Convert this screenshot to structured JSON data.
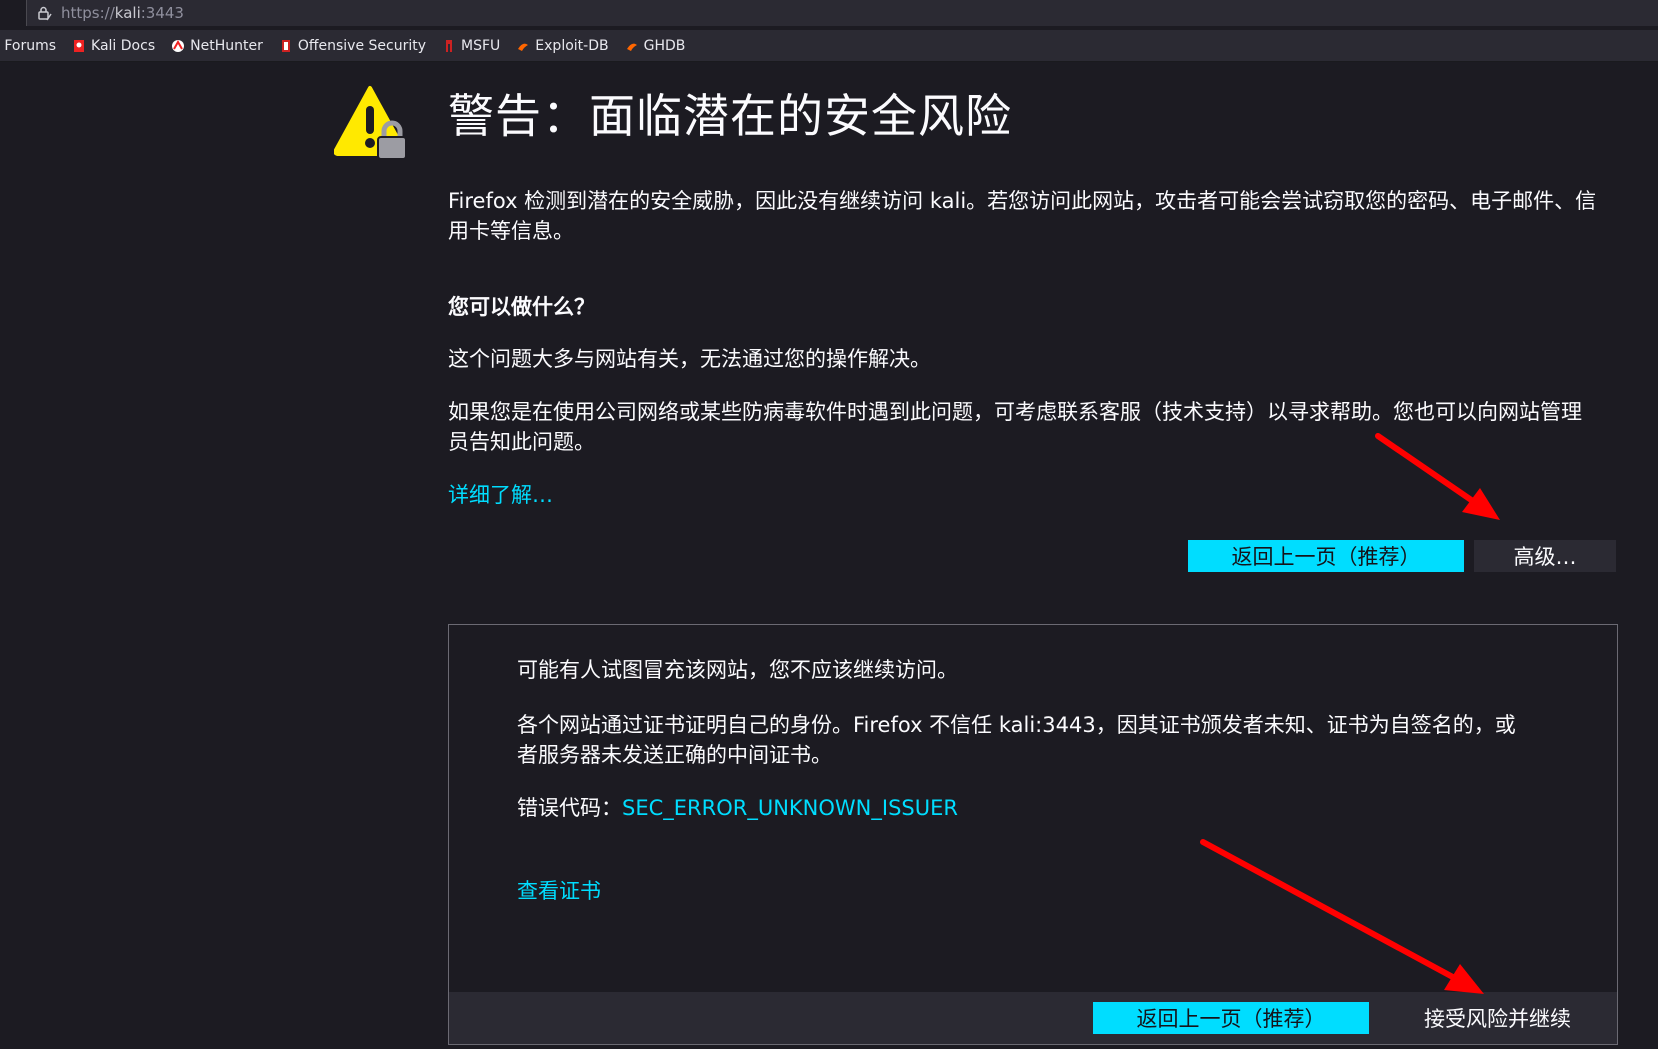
{
  "urlbar": {
    "scheme": "https://",
    "host": "kali",
    "port": ":3443"
  },
  "bookmarks": [
    {
      "label": "i Forums",
      "icon": "none"
    },
    {
      "label": "Kali Docs",
      "icon": "kali-docs-icon"
    },
    {
      "label": "NetHunter",
      "icon": "nethunter-icon"
    },
    {
      "label": "Offensive Security",
      "icon": "offsec-icon"
    },
    {
      "label": "MSFU",
      "icon": "msfu-icon"
    },
    {
      "label": "Exploit-DB",
      "icon": "exploitdb-icon"
    },
    {
      "label": "GHDB",
      "icon": "ghdb-icon"
    }
  ],
  "page": {
    "title": "警告：面临潜在的安全风险",
    "intro": "Firefox 检测到潜在的安全威胁，因此没有继续访问 kali。若您访问此网站，攻击者可能会尝试窃取您的密码、电子邮件、信用卡等信息。",
    "what_can_you_do": "您可以做什么？",
    "problem_site": "这个问题大多与网站有关，无法通过您的操作解决。",
    "company_network": "如果您是在使用公司网络或某些防病毒软件时遇到此问题，可考虑联系客服（技术支持）以寻求帮助。您也可以向网站管理员告知此问题。",
    "learn_more": "详细了解…",
    "go_back": "返回上一页（推荐）",
    "advanced": "高级…"
  },
  "advanced_panel": {
    "impersonate": "可能有人试图冒充该网站，您不应该继续访问。",
    "cert_explain": "各个网站通过证书证明自己的身份。Firefox 不信任 kali:3443，因其证书颁发者未知、证书为自签名的，或者服务器未发送正确的中间证书。",
    "error_code_label": "错误代码：",
    "error_code": "SEC_ERROR_UNKNOWN_ISSUER",
    "view_cert": "查看证书",
    "go_back": "返回上一页（推荐）",
    "accept": "接受风险并继续"
  },
  "colors": {
    "background": "#1c1b22",
    "accent": "#00ddff",
    "warning": "#ffe900",
    "annotation_arrow": "#ff0000"
  }
}
